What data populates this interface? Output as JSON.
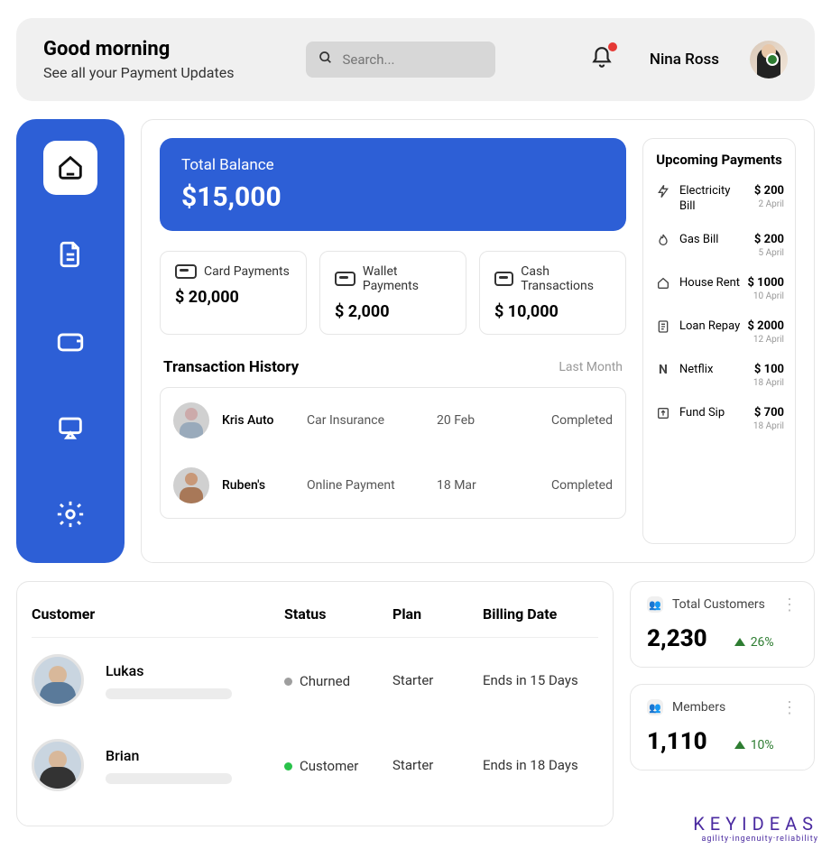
{
  "header": {
    "greeting": "Good morning",
    "subtitle": "See all your Payment Updates",
    "search_placeholder": "Search...",
    "user_name": "Nina Ross"
  },
  "balance": {
    "label": "Total Balance",
    "value": "$15,000"
  },
  "methods": [
    {
      "label": "Card Payments",
      "value": "$ 20,000"
    },
    {
      "label": "Wallet Payments",
      "value": "$ 2,000"
    },
    {
      "label": "Cash Transactions",
      "value": "$ 10,000"
    }
  ],
  "history": {
    "title": "Transaction History",
    "filter": "Last Month",
    "rows": [
      {
        "name": "Kris Auto",
        "type": "Car Insurance",
        "date": "20 Feb",
        "status": "Completed"
      },
      {
        "name": "Ruben's",
        "type": "Online Payment",
        "date": "18 Mar",
        "status": "Completed"
      }
    ]
  },
  "upcoming": {
    "title": "Upcoming Payments",
    "items": [
      {
        "icon": "bolt",
        "name": "Electricity Bill",
        "amount": "$ 200",
        "date": "2 April"
      },
      {
        "icon": "flame",
        "name": "Gas Bill",
        "amount": "$ 200",
        "date": "5 April"
      },
      {
        "icon": "home",
        "name": "House Rent",
        "amount": "$ 1000",
        "date": "10 April"
      },
      {
        "icon": "doc",
        "name": "Loan Repay",
        "amount": "$ 2000",
        "date": "12 April"
      },
      {
        "icon": "netflix",
        "name": "Netflix",
        "amount": "$ 100",
        "date": "18 April"
      },
      {
        "icon": "boxarrow",
        "name": "Fund Sip",
        "amount": "$ 700",
        "date": "18 April"
      }
    ]
  },
  "customers": {
    "headers": {
      "customer": "Customer",
      "status": "Status",
      "plan": "Plan",
      "billing": "Billing Date"
    },
    "rows": [
      {
        "name": "Lukas",
        "status": "Churned",
        "status_color": "#9e9e9e",
        "plan": "Starter",
        "billing": "Ends in 15 Days"
      },
      {
        "name": "Brian",
        "status": "Customer",
        "status_color": "#29c24a",
        "plan": "Starter",
        "billing": "Ends in 18 Days"
      }
    ]
  },
  "stats": [
    {
      "label": "Total Customers",
      "value": "2,230",
      "trend": "26%"
    },
    {
      "label": "Members",
      "value": "1,110",
      "trend": "10%"
    }
  ],
  "brand": {
    "name": "KEYIDEAS",
    "tag": "agility·ingenuity·reliability"
  }
}
